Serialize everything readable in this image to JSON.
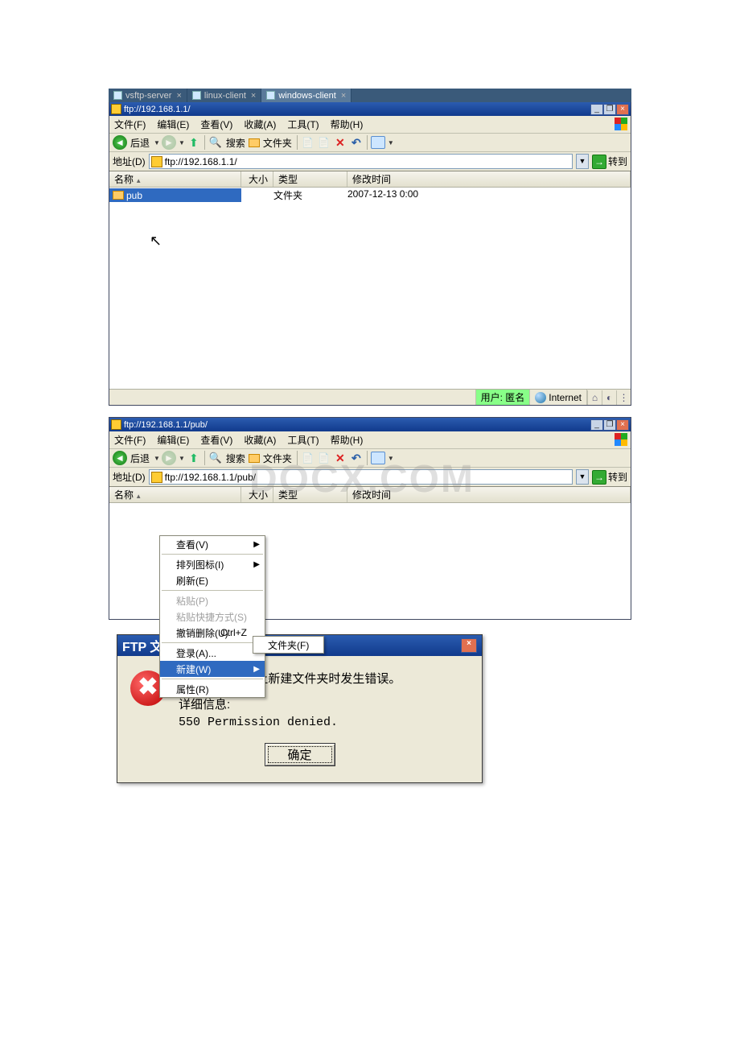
{
  "tabs": [
    {
      "label": "vsftp-server",
      "active": false
    },
    {
      "label": "linux-client",
      "active": false
    },
    {
      "label": "windows-client",
      "active": true
    }
  ],
  "win1": {
    "title": "ftp://192.168.1.1/",
    "menus": {
      "file": "文件(F)",
      "edit": "编辑(E)",
      "view": "查看(V)",
      "fav": "收藏(A)",
      "tools": "工具(T)",
      "help": "帮助(H)"
    },
    "toolbar": {
      "back": "后退",
      "search": "搜索",
      "folders": "文件夹"
    },
    "address": {
      "label": "地址(D)",
      "value": "ftp://192.168.1.1/",
      "go": "转到"
    },
    "headers": {
      "name": "名称",
      "size": "大小",
      "type": "类型",
      "modified": "修改时间"
    },
    "rows": [
      {
        "name": "pub",
        "type": "文件夹",
        "modified": "2007-12-13 0:00",
        "selected": true
      }
    ],
    "status": {
      "user_label": "用户: 匿名",
      "zone": "Internet"
    }
  },
  "win2": {
    "title": "ftp://192.168.1.1/pub/",
    "menus": {
      "file": "文件(F)",
      "edit": "编辑(E)",
      "view": "查看(V)",
      "fav": "收藏(A)",
      "tools": "工具(T)",
      "help": "帮助(H)"
    },
    "toolbar": {
      "back": "后退",
      "search": "搜索",
      "folders": "文件夹"
    },
    "address": {
      "label": "地址(D)",
      "value": "ftp://192.168.1.1/pub/",
      "go": "转到"
    },
    "headers": {
      "name": "名称",
      "size": "大小",
      "type": "类型",
      "modified": "修改时间"
    },
    "context": {
      "view": "查看(V)",
      "arrange": "排列图标(I)",
      "refresh": "刷新(E)",
      "paste": "粘贴(P)",
      "paste_shortcut": "粘贴快捷方式(S)",
      "undo_delete": "撤销删除(U)",
      "undo_shortcut": "Ctrl+Z",
      "login": "登录(A)...",
      "new": "新建(W)",
      "properties": "属性(R)",
      "submenu_folder": "文件夹(F)"
    }
  },
  "dialog": {
    "title": "FTP 文件夹错误",
    "line1": "在 FTP 服务器上新建文件夹时发生错误。",
    "line2": "详细信息:",
    "line3": "550 Permission denied.",
    "ok": "确定"
  },
  "watermark": "DOCX.COM"
}
